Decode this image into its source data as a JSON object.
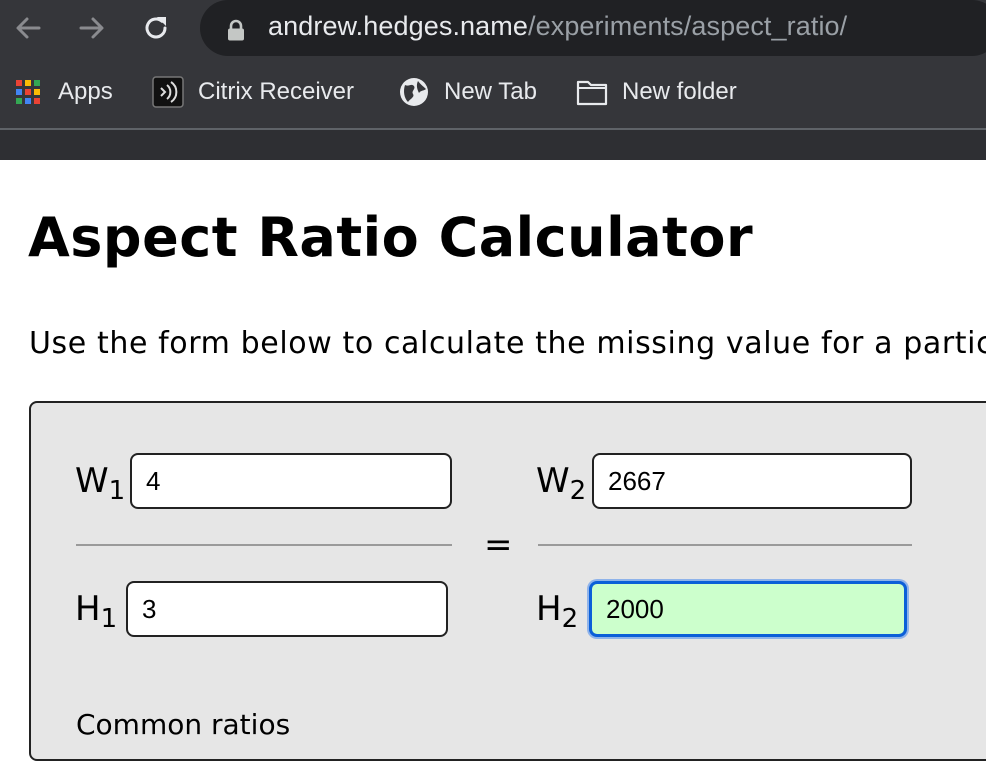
{
  "browser": {
    "url_host": "andrew.hedges.name",
    "url_path": "/experiments/aspect_ratio/",
    "bookmarks": [
      {
        "label": "Apps",
        "icon": "apps-grid-icon"
      },
      {
        "label": "Citrix Receiver",
        "icon": "citrix-icon"
      },
      {
        "label": "New Tab",
        "icon": "globe-icon"
      },
      {
        "label": "New folder",
        "icon": "folder-icon"
      }
    ]
  },
  "page": {
    "title": "Aspect Ratio Calculator",
    "intro": "Use the form below to calculate the missing value for a particu"
  },
  "calculator": {
    "w1": {
      "label": "W",
      "sub": "1",
      "value": "4"
    },
    "h1": {
      "label": "H",
      "sub": "1",
      "value": "3"
    },
    "w2": {
      "label": "W",
      "sub": "2",
      "value": "2667"
    },
    "h2": {
      "label": "H",
      "sub": "2",
      "value": "2000"
    },
    "equals": "=",
    "caption_partial": "Common ratios"
  },
  "colors": {
    "chrome_bg": "#35363a",
    "omnibox_bg": "#202124",
    "calc_bg": "#e6e6e6",
    "active_field_bg": "#ccffcc",
    "focus_ring": "#0b5fd8"
  }
}
